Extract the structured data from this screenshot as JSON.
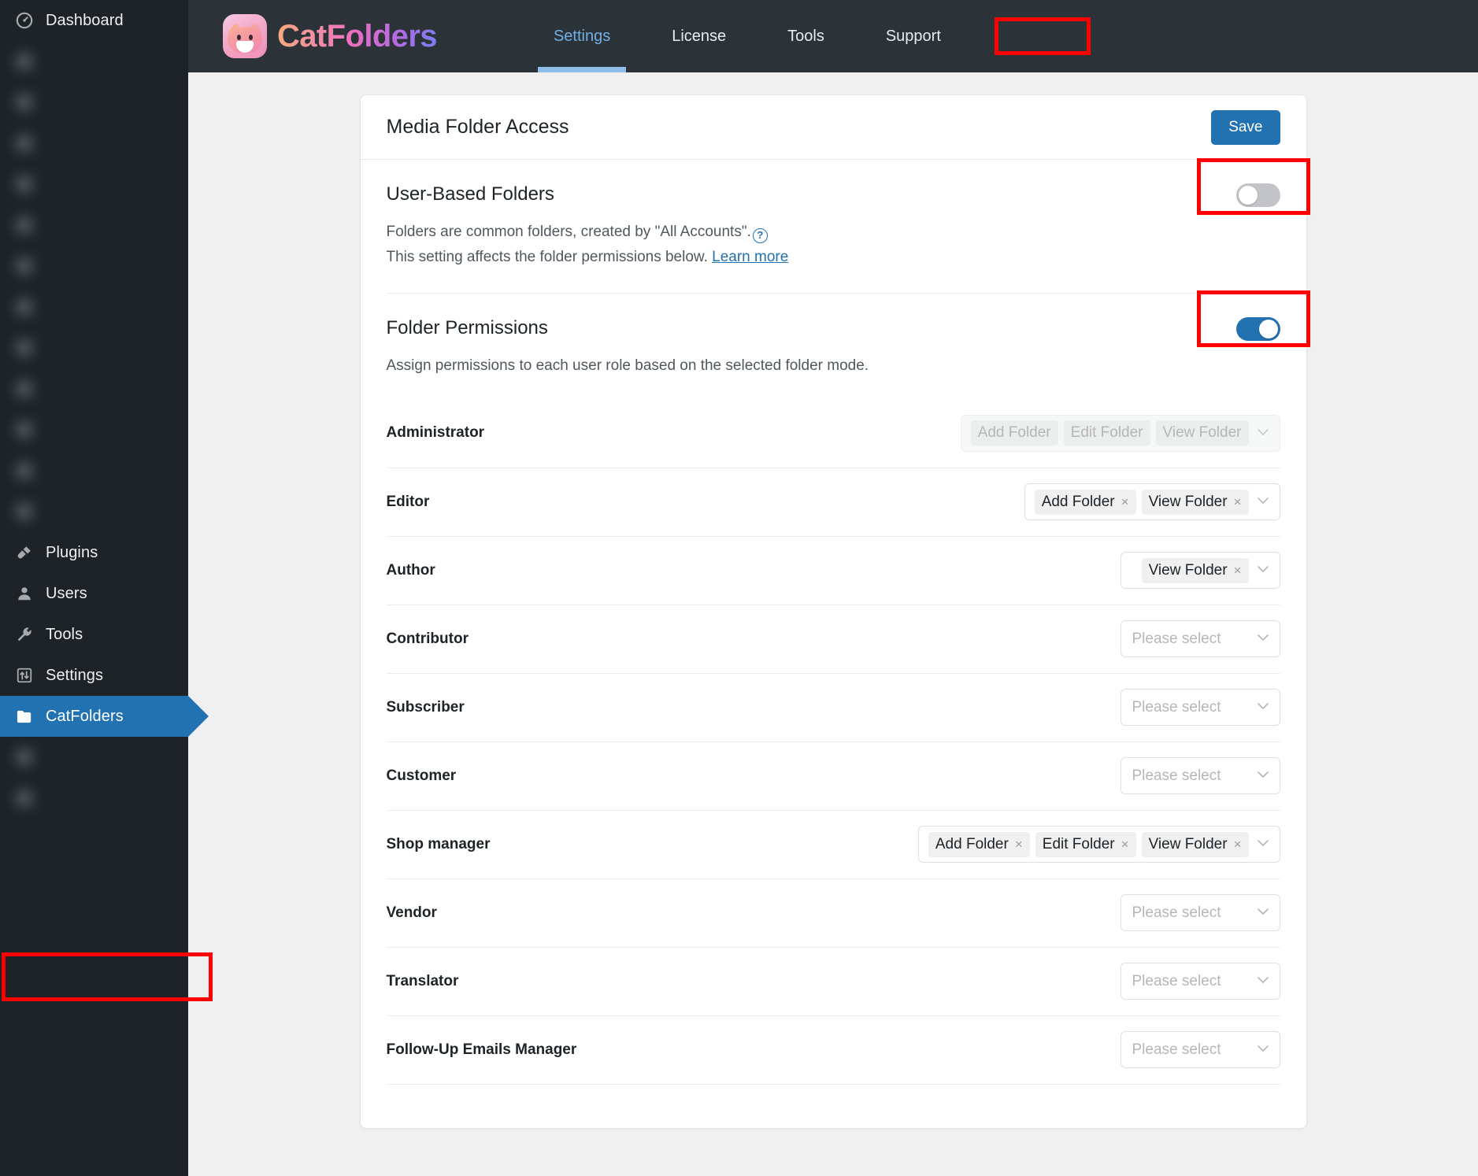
{
  "sidebar": {
    "items": [
      {
        "label": "Dashboard",
        "icon": "dashboard-icon",
        "state": "normal"
      },
      {
        "label": "",
        "icon": "blurred-icon",
        "state": "blurred"
      },
      {
        "label": "",
        "icon": "blurred-icon",
        "state": "blurred"
      },
      {
        "label": "",
        "icon": "blurred-icon",
        "state": "blurred"
      },
      {
        "label": "",
        "icon": "blurred-icon",
        "state": "blurred"
      },
      {
        "label": "",
        "icon": "blurred-icon",
        "state": "blurred"
      },
      {
        "label": "",
        "icon": "blurred-icon",
        "state": "blurred"
      },
      {
        "label": "",
        "icon": "blurred-icon",
        "state": "blurred"
      },
      {
        "label": "",
        "icon": "blurred-icon",
        "state": "blurred"
      },
      {
        "label": "",
        "icon": "blurred-icon",
        "state": "blurred"
      },
      {
        "label": "",
        "icon": "blurred-icon",
        "state": "blurred"
      },
      {
        "label": "",
        "icon": "blurred-icon",
        "state": "blurred"
      },
      {
        "label": "",
        "icon": "blurred-icon",
        "state": "blurred"
      },
      {
        "label": "Plugins",
        "icon": "plug-icon",
        "state": "normal"
      },
      {
        "label": "Users",
        "icon": "user-icon",
        "state": "normal"
      },
      {
        "label": "Tools",
        "icon": "wrench-icon",
        "state": "normal"
      },
      {
        "label": "Settings",
        "icon": "sliders-icon",
        "state": "normal"
      },
      {
        "label": "CatFolders",
        "icon": "folder-icon",
        "state": "current"
      },
      {
        "label": "",
        "icon": "blurred-icon",
        "state": "blurred"
      },
      {
        "label": "",
        "icon": "blurred-icon",
        "state": "blurred"
      }
    ]
  },
  "topbar": {
    "brand_name": "CatFolders",
    "logo_icon": "cat-logo-icon",
    "tabs": [
      {
        "label": "Settings",
        "active": true
      },
      {
        "label": "License",
        "active": false
      },
      {
        "label": "Tools",
        "active": false
      },
      {
        "label": "Support",
        "active": false
      }
    ]
  },
  "card": {
    "title": "Media Folder Access",
    "save_label": "Save",
    "user_based_folders": {
      "title": "User-Based Folders",
      "description_1": "Folders are common folders, created by \"All Accounts\".",
      "help_icon": "question-circle-icon",
      "description_2": "This setting affects the folder permissions below.",
      "learn_more_label": "Learn more",
      "toggle_state": "off"
    },
    "folder_permissions": {
      "title": "Folder Permissions",
      "description": "Assign permissions to each user role based on the selected folder mode.",
      "toggle_state": "on",
      "select_placeholder": "Please select",
      "chevron_icon": "chevron-down-icon",
      "remove_icon": "close-icon",
      "rows": [
        {
          "role": "Administrator",
          "disabled": true,
          "tags": [
            "Add Folder",
            "Edit Folder",
            "View Folder"
          ]
        },
        {
          "role": "Editor",
          "disabled": false,
          "tags": [
            "Add Folder",
            "View Folder"
          ]
        },
        {
          "role": "Author",
          "disabled": false,
          "tags": [
            "View Folder"
          ]
        },
        {
          "role": "Contributor",
          "disabled": false,
          "tags": []
        },
        {
          "role": "Subscriber",
          "disabled": false,
          "tags": []
        },
        {
          "role": "Customer",
          "disabled": false,
          "tags": []
        },
        {
          "role": "Shop manager",
          "disabled": false,
          "tags": [
            "Add Folder",
            "Edit Folder",
            "View Folder"
          ]
        },
        {
          "role": "Vendor",
          "disabled": false,
          "tags": []
        },
        {
          "role": "Translator",
          "disabled": false,
          "tags": []
        },
        {
          "role": "Follow-Up Emails Manager",
          "disabled": false,
          "tags": []
        }
      ]
    }
  },
  "colors": {
    "accent_blue": "#2271b1",
    "annotation_red": "#ff0000",
    "sidebar_bg": "#1d2327",
    "topbar_bg": "#2c3338",
    "page_bg": "#f0f0f1"
  }
}
